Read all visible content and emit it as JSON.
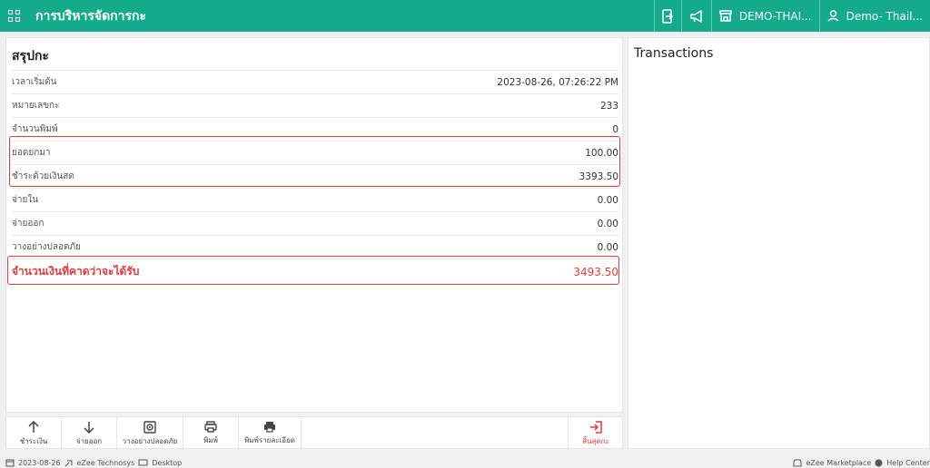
{
  "header": {
    "title": "การบริหารจัดการกะ",
    "store_label": "DEMO-THAI...",
    "user_label": "Demo- Thail..."
  },
  "summary": {
    "title": "สรุปกะ",
    "rows": [
      {
        "label": "เวลาเริ่มต้น",
        "value": "2023-08-26, 07:26:22 PM"
      },
      {
        "label": "หมายเลขกะ",
        "value": "233"
      },
      {
        "label": "จำนวนพิมพ์",
        "value": "0"
      },
      {
        "label": "ยอดยกมา",
        "value": "100.00"
      },
      {
        "label": "ชำระด้วยเงินสด",
        "value": "3393.50"
      },
      {
        "label": "จ่ายใน",
        "value": "0.00"
      },
      {
        "label": "จ่ายออก",
        "value": "0.00"
      },
      {
        "label": "วางอย่างปลอดภัย",
        "value": "0.00"
      }
    ],
    "expected_label": "จำนวนเงินที่คาดว่าจะได้รับ",
    "expected_value": "3493.50",
    "highlight_color": "#e33b3b"
  },
  "toolbar": {
    "pay_in": "ชำระเงิน",
    "pay_out": "จ่ายออก",
    "safe_drop": "วางอย่างปลอดภัย",
    "print": "พิมพ์",
    "print_detail": "พิมพ์รายละเอียด",
    "end_shift": "สิ้นสุดกะ"
  },
  "transactions": {
    "title": "Transactions"
  },
  "statusbar": {
    "date": "2023-08-26",
    "company": "eZee Technosys",
    "device": "Desktop",
    "marketplace": "eZee Marketplace",
    "help": "Help Center"
  },
  "colors": {
    "header_bg": "#13ab8c",
    "accent_red": "#e33b3b"
  }
}
